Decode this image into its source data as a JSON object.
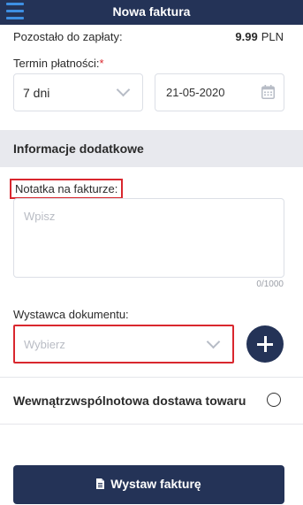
{
  "header": {
    "title": "Nowa faktura"
  },
  "payment": {
    "label": "Pozostało do zapłaty:",
    "amount": "9.99",
    "currency": "PLN"
  },
  "term": {
    "label": "Termin płatności:",
    "required_mark": "*",
    "days_value": "7 dni",
    "date_value": "21-05-2020"
  },
  "section": {
    "title": "Informacje dodatkowe"
  },
  "note": {
    "label": "Notatka na fakturze:",
    "placeholder": "Wpisz",
    "counter": "0/1000"
  },
  "issuer": {
    "label": "Wystawca dokumentu:",
    "placeholder": "Wybierz"
  },
  "intra_community": {
    "label": "Wewnątrzwspólnotowa dostawa towaru",
    "checked": false
  },
  "submit": {
    "label": "Wystaw fakturę"
  },
  "colors": {
    "navy": "#243357",
    "accent_blue": "#3d8fe3",
    "highlight_red": "#d9272e",
    "section_bg": "#e8e9ee"
  },
  "icons": {
    "menu": "hamburger-icon",
    "calendar": "calendar-icon",
    "chevron": "chevron-down-icon",
    "add": "plus-icon",
    "document": "document-icon"
  }
}
